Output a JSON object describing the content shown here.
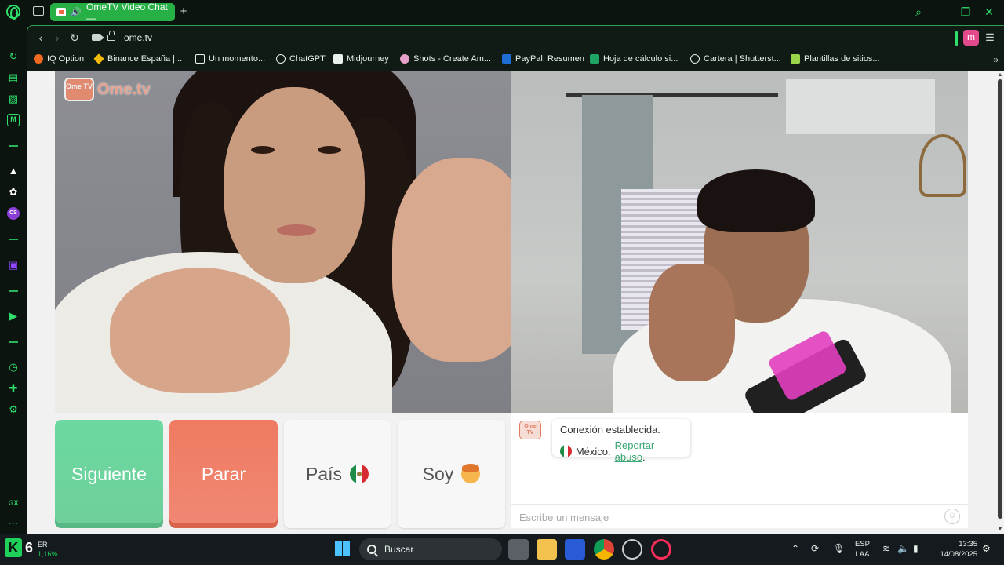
{
  "browser": {
    "tab_title": "OmeTV Video Chat —",
    "url": "ome.tv",
    "profile_initial": "m",
    "bookmarks": [
      {
        "label": "IQ Option",
        "color": "#f26a21"
      },
      {
        "label": "Binance España |...",
        "color": "#f0b90b"
      },
      {
        "label": "Un momento...",
        "color": "#e9f2ec"
      },
      {
        "label": "ChatGPT",
        "color": "#e9f2ec"
      },
      {
        "label": "Midjourney",
        "color": "#e9f2ec"
      },
      {
        "label": "Shots - Create Am...",
        "color": "#e5a0c8"
      },
      {
        "label": "PayPal: Resumen",
        "color": "#1e6ed6"
      },
      {
        "label": "Hoja de cálculo si...",
        "color": "#1fa463"
      },
      {
        "label": "Cartera | Shutterst...",
        "color": "#e9f2ec"
      },
      {
        "label": "Plantillas de sitios...",
        "color": "#9bd64a"
      }
    ],
    "sidebar_bottom_label": "GX"
  },
  "ometv": {
    "logo_tv": "Ome TV",
    "logo_word": "Ome.tv",
    "buttons": {
      "next": "Siguiente",
      "stop": "Parar",
      "country": "País",
      "gender": "Soy"
    },
    "chat": {
      "logo": "Ome TV",
      "status": "Conexión establecida.",
      "country": "México.",
      "report": "Reportar abuso",
      "report_suffix": ".",
      "placeholder": "Escribe un mensaje"
    }
  },
  "taskbar": {
    "widget_value": "6",
    "widget_line1": "ER",
    "widget_line2": "1,16%",
    "search_label": "Buscar",
    "lang_line1": "ESP",
    "lang_line2": "LAA",
    "time": "13:35",
    "date": "14/08/2025"
  },
  "colors": {
    "accent": "#2fe06a",
    "next_button": "#6fd6a0",
    "stop_button": "#ef7c65",
    "report_link": "#3aa673"
  }
}
